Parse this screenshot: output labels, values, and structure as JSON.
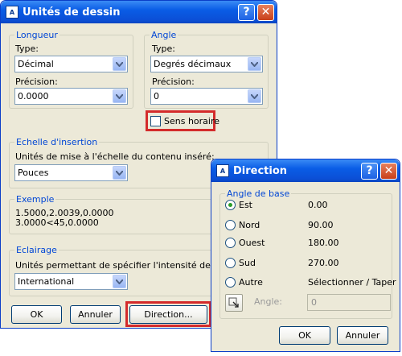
{
  "main_dialog": {
    "title": "Unités de dessin",
    "app_icon_text": "A",
    "help_label": "?",
    "close_label": "✕",
    "length": {
      "group_label": "Longueur",
      "type_label": "Type:",
      "type_value": "Décimal",
      "precision_label": "Précision:",
      "precision_value": "0.0000"
    },
    "angle": {
      "group_label": "Angle",
      "type_label": "Type:",
      "type_value": "Degrés décimaux",
      "precision_label": "Précision:",
      "precision_value": "0",
      "clockwise_label": "Sens horaire",
      "clockwise_checked": false
    },
    "insertion": {
      "group_label": "Echelle d'insertion",
      "description": "Unités de mise à l'échelle du contenu inséré:",
      "value": "Pouces"
    },
    "example": {
      "group_label": "Exemple",
      "line1": "1.5000,2.0039,0.0000",
      "line2": "3.0000<45,0.0000"
    },
    "lighting": {
      "group_label": "Eclairage",
      "description": "Unités permettant de spécifier l'intensité de l'éclairage",
      "value": "International"
    },
    "buttons": {
      "ok": "OK",
      "cancel": "Annuler",
      "direction": "Direction..."
    }
  },
  "direction_dialog": {
    "title": "Direction",
    "app_icon_text": "A",
    "help_label": "?",
    "close_label": "✕",
    "group_label": "Angle de base",
    "options": [
      {
        "label": "Est",
        "value": "0.00",
        "selected": true
      },
      {
        "label": "Nord",
        "value": "90.00",
        "selected": false
      },
      {
        "label": "Ouest",
        "value": "180.00",
        "selected": false
      },
      {
        "label": "Sud",
        "value": "270.00",
        "selected": false
      },
      {
        "label": "Autre",
        "value": "Sélectionner / Taper",
        "selected": false
      }
    ],
    "angle_label": "Angle:",
    "angle_value": "0",
    "buttons": {
      "ok": "OK",
      "cancel": "Annuler"
    }
  },
  "colors": {
    "titlebar": "#0a5de6",
    "group_label": "#0046d5",
    "dialog_bg": "#ece9d8",
    "highlight": "#d42b2b",
    "radio_dot": "#2a9d2a"
  }
}
